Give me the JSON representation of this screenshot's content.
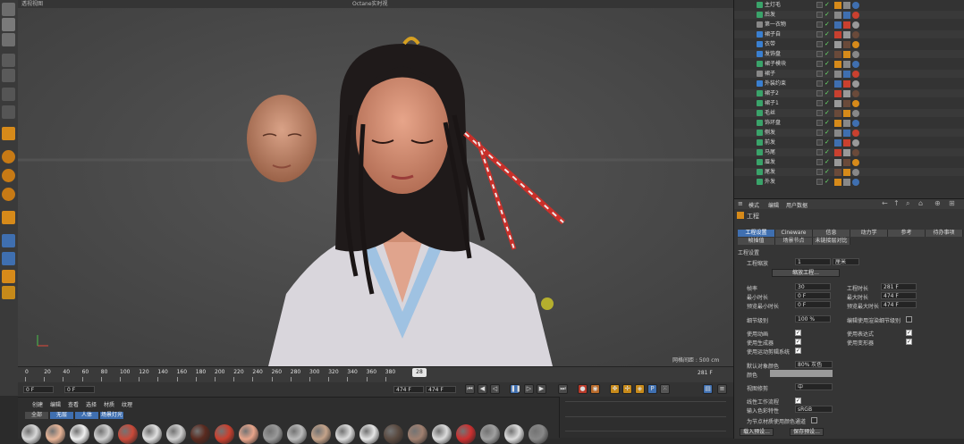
{
  "viewport": {
    "title_left": "透视视图",
    "title_center": "Octane实时视",
    "grid_spacing": "网格间距 : 500 cm"
  },
  "timeline": {
    "ticks": [
      "0",
      "20",
      "40",
      "60",
      "80",
      "100",
      "120",
      "140",
      "160",
      "180",
      "200",
      "220",
      "240",
      "260",
      "280",
      "300",
      "320",
      "340",
      "360",
      "380"
    ],
    "current_frame": "28",
    "end_label": "281 F"
  },
  "transport": {
    "start_field": "0 F",
    "min_field": "0 F",
    "max_field": "474 F",
    "end_field": "474 F"
  },
  "materials": {
    "menu": [
      "创建",
      "编辑",
      "查看",
      "选择",
      "材质",
      "纹理"
    ],
    "filters": [
      "全部",
      "无层",
      "人体",
      "场景灯光"
    ]
  },
  "object_manager": {
    "rows": [
      {
        "name": "主灯毛",
        "color": "#3aa36a"
      },
      {
        "name": "后发",
        "color": "#3aa36a"
      },
      {
        "name": "第一衣物",
        "color": "#888888"
      },
      {
        "name": "裙子自",
        "color": "#3a7fd0"
      },
      {
        "name": "衣带",
        "color": "#3a7fd0"
      },
      {
        "name": "发饰盘",
        "color": "#3a7fd0"
      },
      {
        "name": "裙子模块",
        "color": "#3aa36a"
      },
      {
        "name": "裙子",
        "color": "#888888"
      },
      {
        "name": "外装约束",
        "color": "#3a7fd0"
      },
      {
        "name": "裙子2",
        "color": "#3aa36a"
      },
      {
        "name": "裙子1",
        "color": "#3aa36a"
      },
      {
        "name": "毛丝",
        "color": "#3aa36a"
      },
      {
        "name": "饰环盘",
        "color": "#3aa36a"
      },
      {
        "name": "侧发",
        "color": "#3aa36a"
      },
      {
        "name": "前发",
        "color": "#3aa36a"
      },
      {
        "name": "马尾",
        "color": "#3aa36a"
      },
      {
        "name": "眉发",
        "color": "#3aa36a"
      },
      {
        "name": "尾发",
        "color": "#3aa36a"
      },
      {
        "name": "外发",
        "color": "#3aa36a"
      }
    ]
  },
  "attributes": {
    "header_menu": [
      "模式",
      "编辑",
      "用户数据"
    ],
    "object_title": "工程",
    "tabs_row1": [
      "工程设置",
      "Cineware",
      "信息",
      "动力学",
      "参考",
      "待办事项"
    ],
    "tabs_row2": [
      "帧插值",
      "场景节点",
      "未链接层对比"
    ],
    "section": "工程设置",
    "project_scale_label": "工程缩放",
    "project_scale_value": "1",
    "project_scale_unit": "厘米",
    "scale_button": "缩放工程...",
    "fps_label": "帧率",
    "fps_value": "30",
    "project_length_label": "工程时长",
    "project_length_value": "281 F",
    "min_time_label": "最小时长",
    "min_time_value": "0 F",
    "max_time_label": "最大时长",
    "max_time_value": "474 F",
    "preview_min_label": "预览最小时长",
    "preview_min_value": "0 F",
    "preview_max_label": "预览最大时长",
    "preview_max_value": "474 F",
    "lod_label": "细节级别",
    "lod_value": "100 %",
    "render_lod_label": "编辑使用渲染细节级别",
    "use_anim_label": "使用动画",
    "use_expr_label": "使用表达式",
    "use_gen_label": "使用生成器",
    "use_deform_label": "使用变形器",
    "use_motion_label": "使用运动剪辑系统",
    "default_color_label": "默认对象颜色",
    "default_color_value": "80% 灰色",
    "color_label": "颜色",
    "view_clip_label": "视图修剪",
    "view_clip_value": "中",
    "linear_workflow_label": "线性工作流程",
    "input_color_label": "输入色彩特性",
    "input_color_value": "sRGB",
    "node_color_label": "为节点材质使用颜色通道",
    "load_preset": "载入预设...",
    "save_preset": "保存预设..."
  },
  "colors": {
    "accent_blue": "#3f6fb0",
    "playhead": "#e6e6e6",
    "green_check": "#6adf6a"
  }
}
